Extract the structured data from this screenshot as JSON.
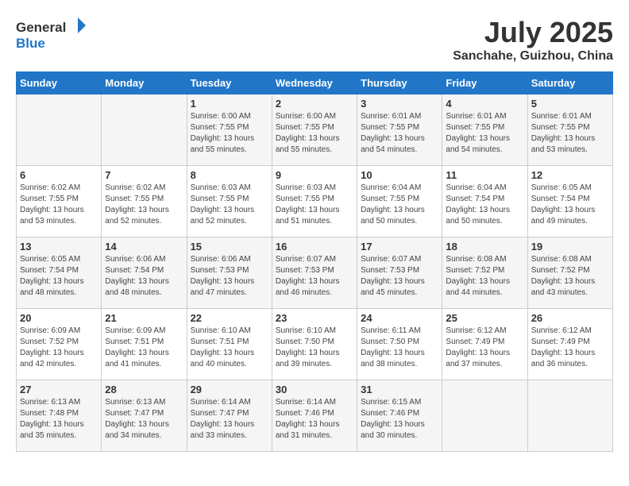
{
  "header": {
    "logo_general": "General",
    "logo_blue": "Blue",
    "month": "July 2025",
    "location": "Sanchahe, Guizhou, China"
  },
  "days_of_week": [
    "Sunday",
    "Monday",
    "Tuesday",
    "Wednesday",
    "Thursday",
    "Friday",
    "Saturday"
  ],
  "weeks": [
    [
      {
        "day": "",
        "info": ""
      },
      {
        "day": "",
        "info": ""
      },
      {
        "day": "1",
        "info": "Sunrise: 6:00 AM\nSunset: 7:55 PM\nDaylight: 13 hours and 55 minutes."
      },
      {
        "day": "2",
        "info": "Sunrise: 6:00 AM\nSunset: 7:55 PM\nDaylight: 13 hours and 55 minutes."
      },
      {
        "day": "3",
        "info": "Sunrise: 6:01 AM\nSunset: 7:55 PM\nDaylight: 13 hours and 54 minutes."
      },
      {
        "day": "4",
        "info": "Sunrise: 6:01 AM\nSunset: 7:55 PM\nDaylight: 13 hours and 54 minutes."
      },
      {
        "day": "5",
        "info": "Sunrise: 6:01 AM\nSunset: 7:55 PM\nDaylight: 13 hours and 53 minutes."
      }
    ],
    [
      {
        "day": "6",
        "info": "Sunrise: 6:02 AM\nSunset: 7:55 PM\nDaylight: 13 hours and 53 minutes."
      },
      {
        "day": "7",
        "info": "Sunrise: 6:02 AM\nSunset: 7:55 PM\nDaylight: 13 hours and 52 minutes."
      },
      {
        "day": "8",
        "info": "Sunrise: 6:03 AM\nSunset: 7:55 PM\nDaylight: 13 hours and 52 minutes."
      },
      {
        "day": "9",
        "info": "Sunrise: 6:03 AM\nSunset: 7:55 PM\nDaylight: 13 hours and 51 minutes."
      },
      {
        "day": "10",
        "info": "Sunrise: 6:04 AM\nSunset: 7:55 PM\nDaylight: 13 hours and 50 minutes."
      },
      {
        "day": "11",
        "info": "Sunrise: 6:04 AM\nSunset: 7:54 PM\nDaylight: 13 hours and 50 minutes."
      },
      {
        "day": "12",
        "info": "Sunrise: 6:05 AM\nSunset: 7:54 PM\nDaylight: 13 hours and 49 minutes."
      }
    ],
    [
      {
        "day": "13",
        "info": "Sunrise: 6:05 AM\nSunset: 7:54 PM\nDaylight: 13 hours and 48 minutes."
      },
      {
        "day": "14",
        "info": "Sunrise: 6:06 AM\nSunset: 7:54 PM\nDaylight: 13 hours and 48 minutes."
      },
      {
        "day": "15",
        "info": "Sunrise: 6:06 AM\nSunset: 7:53 PM\nDaylight: 13 hours and 47 minutes."
      },
      {
        "day": "16",
        "info": "Sunrise: 6:07 AM\nSunset: 7:53 PM\nDaylight: 13 hours and 46 minutes."
      },
      {
        "day": "17",
        "info": "Sunrise: 6:07 AM\nSunset: 7:53 PM\nDaylight: 13 hours and 45 minutes."
      },
      {
        "day": "18",
        "info": "Sunrise: 6:08 AM\nSunset: 7:52 PM\nDaylight: 13 hours and 44 minutes."
      },
      {
        "day": "19",
        "info": "Sunrise: 6:08 AM\nSunset: 7:52 PM\nDaylight: 13 hours and 43 minutes."
      }
    ],
    [
      {
        "day": "20",
        "info": "Sunrise: 6:09 AM\nSunset: 7:52 PM\nDaylight: 13 hours and 42 minutes."
      },
      {
        "day": "21",
        "info": "Sunrise: 6:09 AM\nSunset: 7:51 PM\nDaylight: 13 hours and 41 minutes."
      },
      {
        "day": "22",
        "info": "Sunrise: 6:10 AM\nSunset: 7:51 PM\nDaylight: 13 hours and 40 minutes."
      },
      {
        "day": "23",
        "info": "Sunrise: 6:10 AM\nSunset: 7:50 PM\nDaylight: 13 hours and 39 minutes."
      },
      {
        "day": "24",
        "info": "Sunrise: 6:11 AM\nSunset: 7:50 PM\nDaylight: 13 hours and 38 minutes."
      },
      {
        "day": "25",
        "info": "Sunrise: 6:12 AM\nSunset: 7:49 PM\nDaylight: 13 hours and 37 minutes."
      },
      {
        "day": "26",
        "info": "Sunrise: 6:12 AM\nSunset: 7:49 PM\nDaylight: 13 hours and 36 minutes."
      }
    ],
    [
      {
        "day": "27",
        "info": "Sunrise: 6:13 AM\nSunset: 7:48 PM\nDaylight: 13 hours and 35 minutes."
      },
      {
        "day": "28",
        "info": "Sunrise: 6:13 AM\nSunset: 7:47 PM\nDaylight: 13 hours and 34 minutes."
      },
      {
        "day": "29",
        "info": "Sunrise: 6:14 AM\nSunset: 7:47 PM\nDaylight: 13 hours and 33 minutes."
      },
      {
        "day": "30",
        "info": "Sunrise: 6:14 AM\nSunset: 7:46 PM\nDaylight: 13 hours and 31 minutes."
      },
      {
        "day": "31",
        "info": "Sunrise: 6:15 AM\nSunset: 7:46 PM\nDaylight: 13 hours and 30 minutes."
      },
      {
        "day": "",
        "info": ""
      },
      {
        "day": "",
        "info": ""
      }
    ]
  ]
}
